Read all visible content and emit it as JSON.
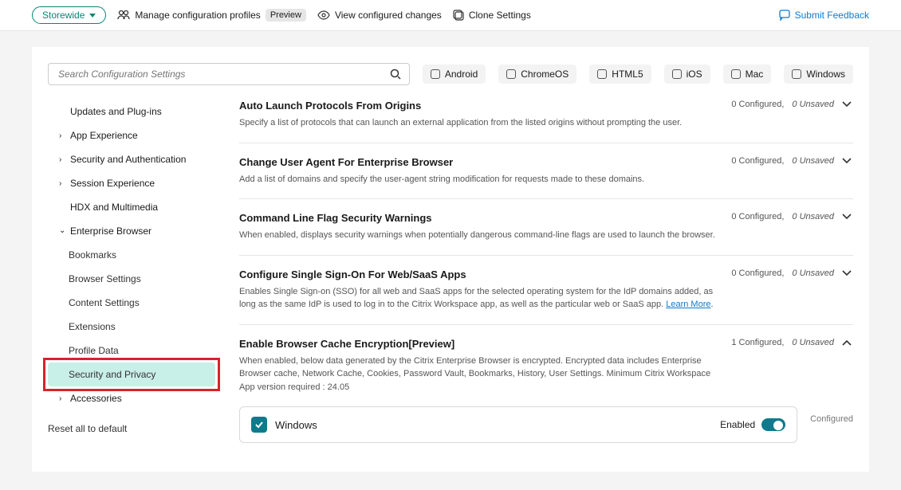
{
  "topbar": {
    "scope": "Storewide",
    "manage": "Manage configuration profiles",
    "preview_badge": "Preview",
    "view_changes": "View configured changes",
    "clone": "Clone Settings",
    "feedback": "Submit Feedback"
  },
  "search": {
    "placeholder": "Search Configuration Settings"
  },
  "os": {
    "android": "Android",
    "chromeos": "ChromeOS",
    "html5": "HTML5",
    "ios": "iOS",
    "mac": "Mac",
    "windows": "Windows"
  },
  "sidebar": {
    "updates": "Updates and Plug-ins",
    "app_exp": "App Experience",
    "sec_auth": "Security and Authentication",
    "sess_exp": "Session Experience",
    "hdx": "HDX and Multimedia",
    "ebrowser": "Enterprise Browser",
    "bookmarks": "Bookmarks",
    "browser_settings": "Browser Settings",
    "content_settings": "Content Settings",
    "extensions": "Extensions",
    "profile_data": "Profile Data",
    "sec_priv": "Security and Privacy",
    "accessories": "Accessories",
    "reset": "Reset all to default"
  },
  "settings": [
    {
      "title": "Auto Launch Protocols From Origins",
      "desc": "Specify a list of protocols that can launch an external application from the listed origins without prompting the user.",
      "configured": "0 Configured,",
      "unsaved": "0 Unsaved",
      "expanded": false
    },
    {
      "title": "Change User Agent For Enterprise Browser",
      "desc": "Add a list of domains and specify the user-agent string modification for requests made to these domains.",
      "configured": "0 Configured,",
      "unsaved": "0 Unsaved",
      "expanded": false
    },
    {
      "title": "Command Line Flag Security Warnings",
      "desc": "When enabled, displays security warnings when potentially dangerous command-line flags are used to launch the browser.",
      "configured": "0 Configured,",
      "unsaved": "0 Unsaved",
      "expanded": false
    },
    {
      "title": "Configure Single Sign-On For Web/SaaS Apps",
      "desc": "Enables Single Sign-on (SSO) for all web and SaaS apps for the selected operating system for the IdP domains added, as long as the same IdP is used to log in to the Citrix Workspace app, as well as the particular web or SaaS app. ",
      "link": "Learn More",
      "configured": "0 Configured,",
      "unsaved": "0 Unsaved",
      "expanded": false
    },
    {
      "title": "Enable Browser Cache Encryption[Preview]",
      "desc": "When enabled, below data generated by the Citrix Enterprise Browser is encrypted. Encrypted data includes Enterprise Browser cache, Network Cache, Cookies, Password Vault, Bookmarks, History, User Settings. Minimum Citrix Workspace App version required : 24.05",
      "configured": "1 Configured,",
      "unsaved": "0 Unsaved",
      "expanded": true
    }
  ],
  "config": {
    "enabled_label": "Enabled",
    "platform": "Windows",
    "status": "Configured"
  }
}
